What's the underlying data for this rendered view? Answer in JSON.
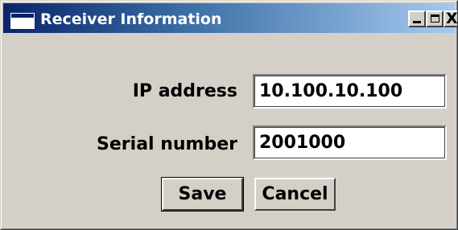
{
  "window": {
    "title": "Receiver Information",
    "icon": "window-app-icon",
    "controls": {
      "minimize": "minimize-icon",
      "maximize": "maximize-icon",
      "close_glyph": "X"
    }
  },
  "form": {
    "ip": {
      "label": "IP address",
      "value": "10.100.10.100"
    },
    "serial": {
      "label": "Serial number",
      "value": "2001000"
    }
  },
  "buttons": {
    "save": "Save",
    "cancel": "Cancel"
  }
}
